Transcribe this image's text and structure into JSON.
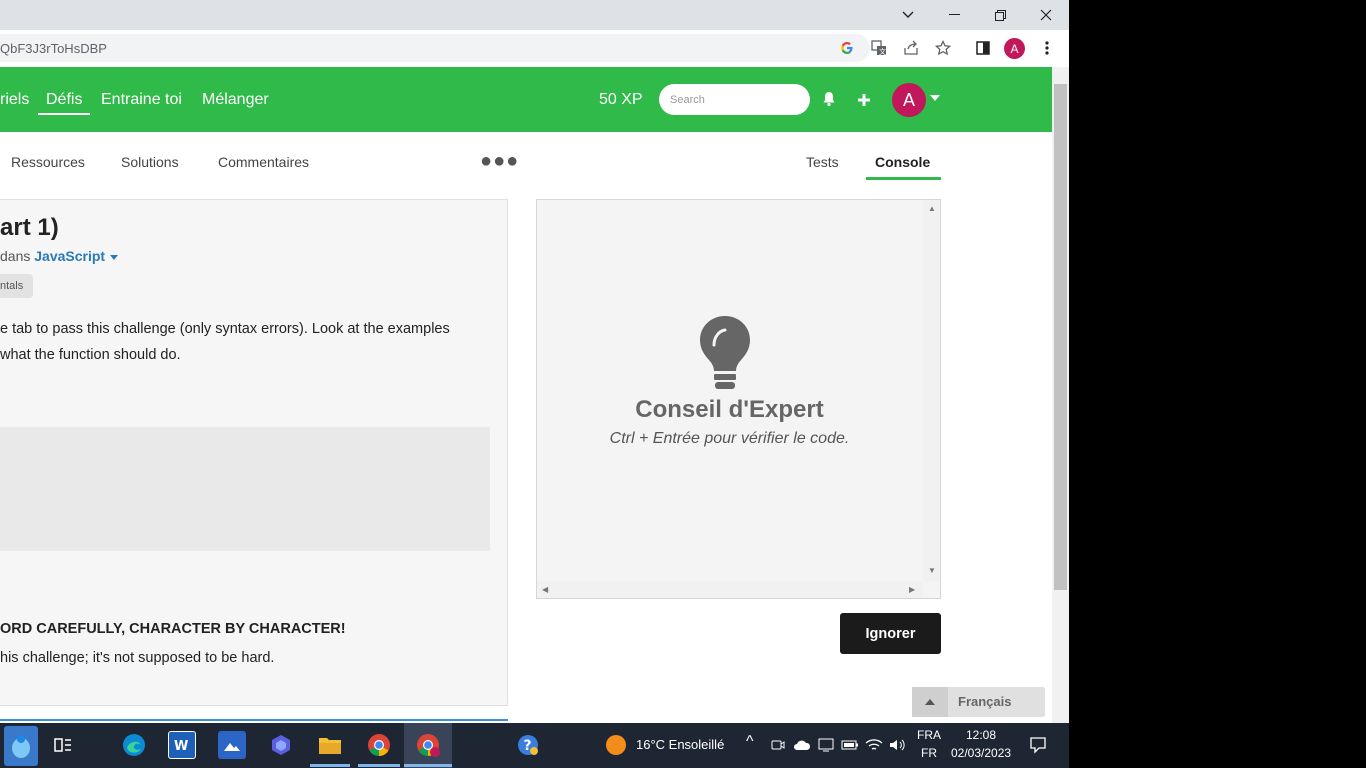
{
  "browser": {
    "url_fragment": "QbF3J3rToHsDBP",
    "profile_initial": "A",
    "window_controls": [
      "chevron-down",
      "minimize",
      "restore",
      "close"
    ]
  },
  "header": {
    "nav": [
      {
        "label": "riels"
      },
      {
        "label": "Défis"
      },
      {
        "label": "Entraine toi"
      },
      {
        "label": "Mélanger"
      }
    ],
    "xp": "50 XP",
    "search_placeholder": "Search",
    "avatar_initial": "A",
    "accent": "#2fba4a"
  },
  "tabs": {
    "left": [
      "Ressources",
      "Solutions",
      "Commentaires"
    ],
    "right": [
      "Tests",
      "Console"
    ],
    "active": "Console"
  },
  "description": {
    "title": "art 1)",
    "in_prefix": "dans",
    "language": "JavaScript",
    "tag": "ntals",
    "text_line1": "e tab to pass this challenge (only syntax errors). Look at the examples",
    "text_line2": "what the function should do.",
    "warning": "ORD CAREFULLY, CHARACTER BY CHARACTER!",
    "note": "his challenge; it's not supposed to be hard."
  },
  "console": {
    "tip_title": "Conseil d'Expert",
    "tip_text": "Ctrl + Entrée pour vérifier le code.",
    "ignore_label": "Ignorer"
  },
  "language_selector": {
    "label": "Français"
  },
  "taskbar": {
    "weather": "16°C  Ensoleillé",
    "lang_top": "FRA",
    "lang_bottom": "FR",
    "time": "12:08",
    "date": "02/03/2023"
  }
}
